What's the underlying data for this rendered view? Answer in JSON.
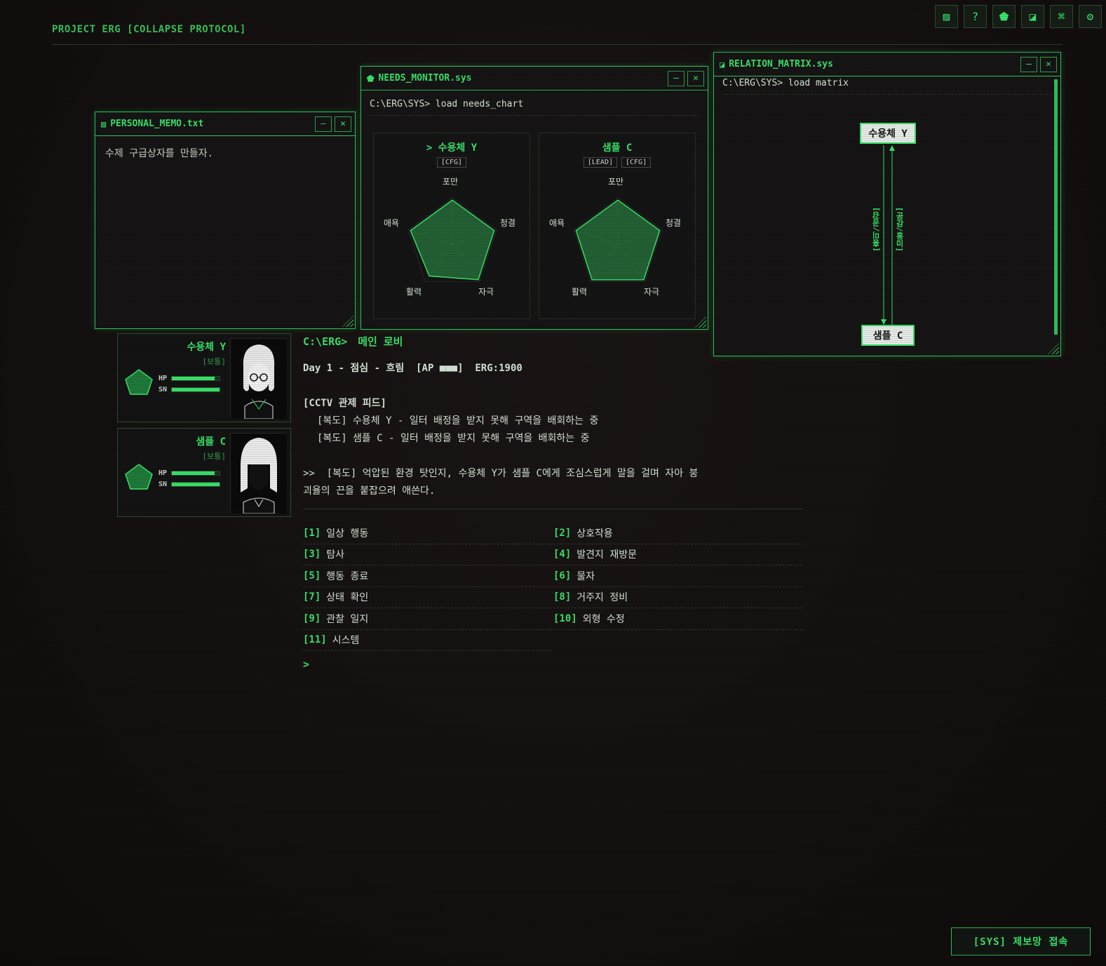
{
  "app_title": "PROJECT ERG [COLLAPSE PROTOCOL]",
  "toolbar": {
    "icons": [
      "memo-icon",
      "help-icon",
      "needs-icon",
      "relation-icon",
      "command-icon",
      "settings-icon"
    ],
    "glyphs": [
      "▨",
      "?",
      "⬟",
      "◪",
      "⌘",
      "⚙"
    ]
  },
  "memo_window": {
    "title": "PERSONAL_MEMO.txt",
    "content": "수제 구급상자를 만들자.",
    "minimize": "–",
    "close": "✕"
  },
  "needs_window": {
    "title": "NEEDS_MONITOR.sys",
    "command": "C:\\ERG\\SYS> load needs_chart",
    "minimize": "–",
    "close": "✕",
    "charts": [
      {
        "name": "> 수용체 Y",
        "tags": [
          "[CFG]"
        ],
        "axes": [
          "포만",
          "청결",
          "자극",
          "활력",
          "애욕"
        ],
        "values": [
          0.95,
          0.95,
          0.95,
          0.85,
          0.95
        ]
      },
      {
        "name": "샘플 C",
        "tags": [
          "[LEAD]",
          "[CFG]"
        ],
        "axes": [
          "포만",
          "청결",
          "자극",
          "활력",
          "애욕"
        ],
        "values": [
          0.95,
          0.95,
          0.95,
          0.95,
          0.95
        ]
      }
    ]
  },
  "relation_window": {
    "title": "RELATION_MATRIX.sys",
    "command": "C:\\ERG\\SYS> load matrix",
    "minimize": "–",
    "close": "✕",
    "node_top": "수용체 Y",
    "node_bottom": "샘플 C",
    "edge_left": "[흥미/공감]",
    "edge_right": "[공감/흥미]"
  },
  "characters": [
    {
      "name": "수용체 Y",
      "status": "[보통]",
      "hp_label": "HP",
      "sn_label": "SN",
      "hp": 0.9,
      "sn": 1.0
    },
    {
      "name": "샘플 C",
      "status": "[보통]",
      "hp_label": "HP",
      "sn_label": "SN",
      "hp": 0.9,
      "sn": 1.0
    }
  ],
  "main": {
    "prompt_path": "C:\\ERG>",
    "location": "메인 로비",
    "status_line": "Day 1 - 점심 - 흐림  [AP ■■■]  ERG:1900",
    "cctv_header": "[CCTV 관제 피드]",
    "cctv_lines": [
      "[복도] 수용체 Y - 일터 배정을 받지 못해 구역을 배회하는 중",
      "[복도] 샘플 C - 일터 배정을 받지 못해 구역을 배회하는 중"
    ],
    "narration_line1": ">>  [복도] 억압된 환경 탓인지, 수용체 Y가 샘플 C에게 조심스럽게 말을 걸며 자아 붕",
    "narration_line2": "괴율의 끈을 붙잡으려 애쓴다.",
    "menu": [
      {
        "num": "[1]",
        "label": "일상 행동"
      },
      {
        "num": "[2]",
        "label": "상호작용"
      },
      {
        "num": "[3]",
        "label": "탐사"
      },
      {
        "num": "[4]",
        "label": "발견지 재방문"
      },
      {
        "num": "[5]",
        "label": "행동 종료"
      },
      {
        "num": "[6]",
        "label": "물자"
      },
      {
        "num": "[7]",
        "label": "상태 확인"
      },
      {
        "num": "[8]",
        "label": "거주지 정비"
      },
      {
        "num": "[9]",
        "label": "관찰 일지"
      },
      {
        "num": "[10]",
        "label": "외형 수정"
      },
      {
        "num": "[11]",
        "label": "시스템"
      }
    ],
    "input_prompt": ">"
  },
  "sys_button": "[SYS] 제보망 접속",
  "colors": {
    "accent": "#39e46a",
    "background": "#141010",
    "panel": "#161414"
  }
}
